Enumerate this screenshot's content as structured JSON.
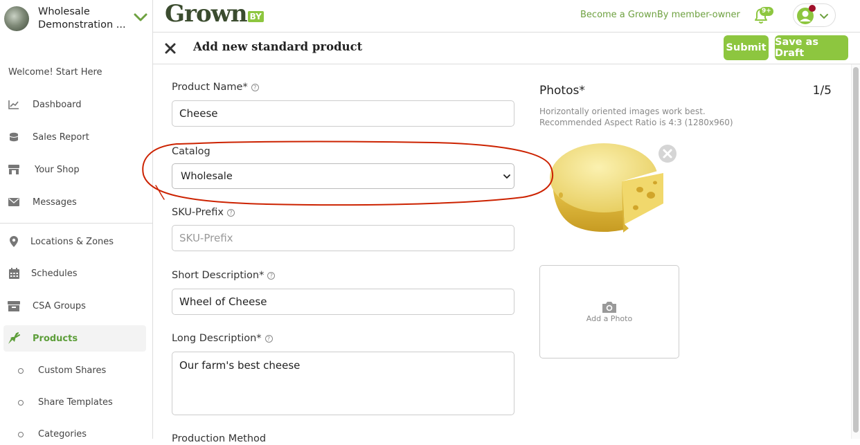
{
  "org": {
    "name_line1": "Wholesale",
    "name_line2": "Demonstration ..."
  },
  "sidebar": {
    "welcome": "Welcome! Start Here",
    "items": [
      {
        "label": "Dashboard",
        "icon": "chart-icon"
      },
      {
        "label": "Sales Report",
        "icon": "coins-icon"
      },
      {
        "label": "Your Shop",
        "icon": "store-icon"
      },
      {
        "label": "Messages",
        "icon": "envelope-icon"
      },
      {
        "label": "Locations & Zones",
        "icon": "map-pin-icon"
      },
      {
        "label": "Schedules",
        "icon": "calendar-icon"
      },
      {
        "label": "CSA Groups",
        "icon": "box-icon"
      },
      {
        "label": "Products",
        "icon": "carrot-icon"
      }
    ],
    "sub_items": [
      "Custom Shares",
      "Share Templates",
      "Categories"
    ]
  },
  "topbar": {
    "brand_main": "Grown",
    "brand_suffix": "BY",
    "member_link": "Become a GrownBy member-owner",
    "notifications_badge": "9+"
  },
  "header": {
    "title": "Add new standard product",
    "submit_label": "Submit",
    "draft_label": "Save as Draft"
  },
  "form": {
    "product_name_label": "Product Name*",
    "product_name_value": "Cheese",
    "catalog_label": "Catalog",
    "catalog_value": "Wholesale",
    "sku_label": "SKU-Prefix",
    "sku_placeholder": "SKU-Prefix",
    "short_desc_label": "Short Description*",
    "short_desc_value": "Wheel of Cheese",
    "long_desc_label": "Long Description*",
    "long_desc_value": "Our farm's best cheese",
    "next_label": "Production Method"
  },
  "photos": {
    "title": "Photos*",
    "count": "1/5",
    "hint_line1": "Horizontally oriented images work best.",
    "hint_line2": "Recommended Aspect Ratio is 4:3 (1280x960)",
    "add_label": "Add a Photo"
  },
  "colors": {
    "accent": "#8dc63f",
    "brand_dark": "#3b4c2f",
    "link": "#6ea140",
    "annotation": "#cc2200"
  }
}
